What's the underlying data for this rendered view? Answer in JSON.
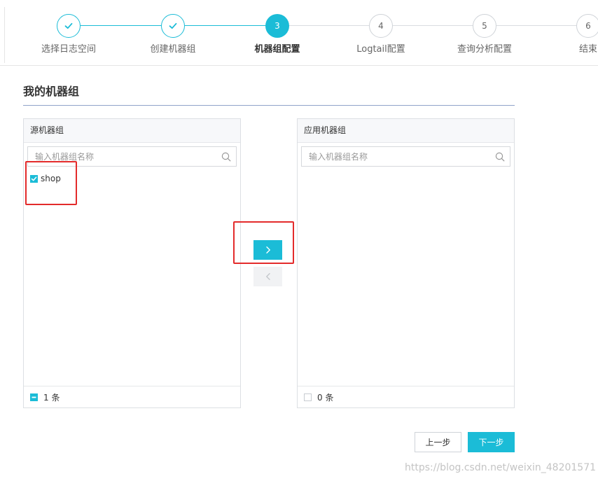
{
  "steps": [
    {
      "number": "1",
      "label": "选择日志空间",
      "status": "done"
    },
    {
      "number": "2",
      "label": "创建机器组",
      "status": "done"
    },
    {
      "number": "3",
      "label": "机器组配置",
      "status": "active"
    },
    {
      "number": "4",
      "label": "Logtail配置",
      "status": "todo"
    },
    {
      "number": "5",
      "label": "查询分析配置",
      "status": "todo"
    },
    {
      "number": "6",
      "label": "结束",
      "status": "todo"
    }
  ],
  "page": {
    "title": "我的机器组"
  },
  "source_panel": {
    "title": "源机器组",
    "search_placeholder": "输入机器组名称",
    "items": [
      {
        "label": "shop",
        "checked": true
      }
    ],
    "footer_count": "1 条",
    "select_all_state": "partial"
  },
  "target_panel": {
    "title": "应用机器组",
    "search_placeholder": "输入机器组名称",
    "items": [],
    "footer_count": "0 条",
    "select_all_state": "none"
  },
  "transfer": {
    "right_icon": "chevron-right-icon",
    "left_icon": "chevron-left-icon"
  },
  "actions": {
    "prev_label": "上一步",
    "next_label": "下一步"
  },
  "watermark": "https://blog.csdn.net/weixin_48201571",
  "colors": {
    "accent": "#1bbcd7",
    "highlight": "#e32b2b",
    "title_rule": "#8fa3c9"
  }
}
